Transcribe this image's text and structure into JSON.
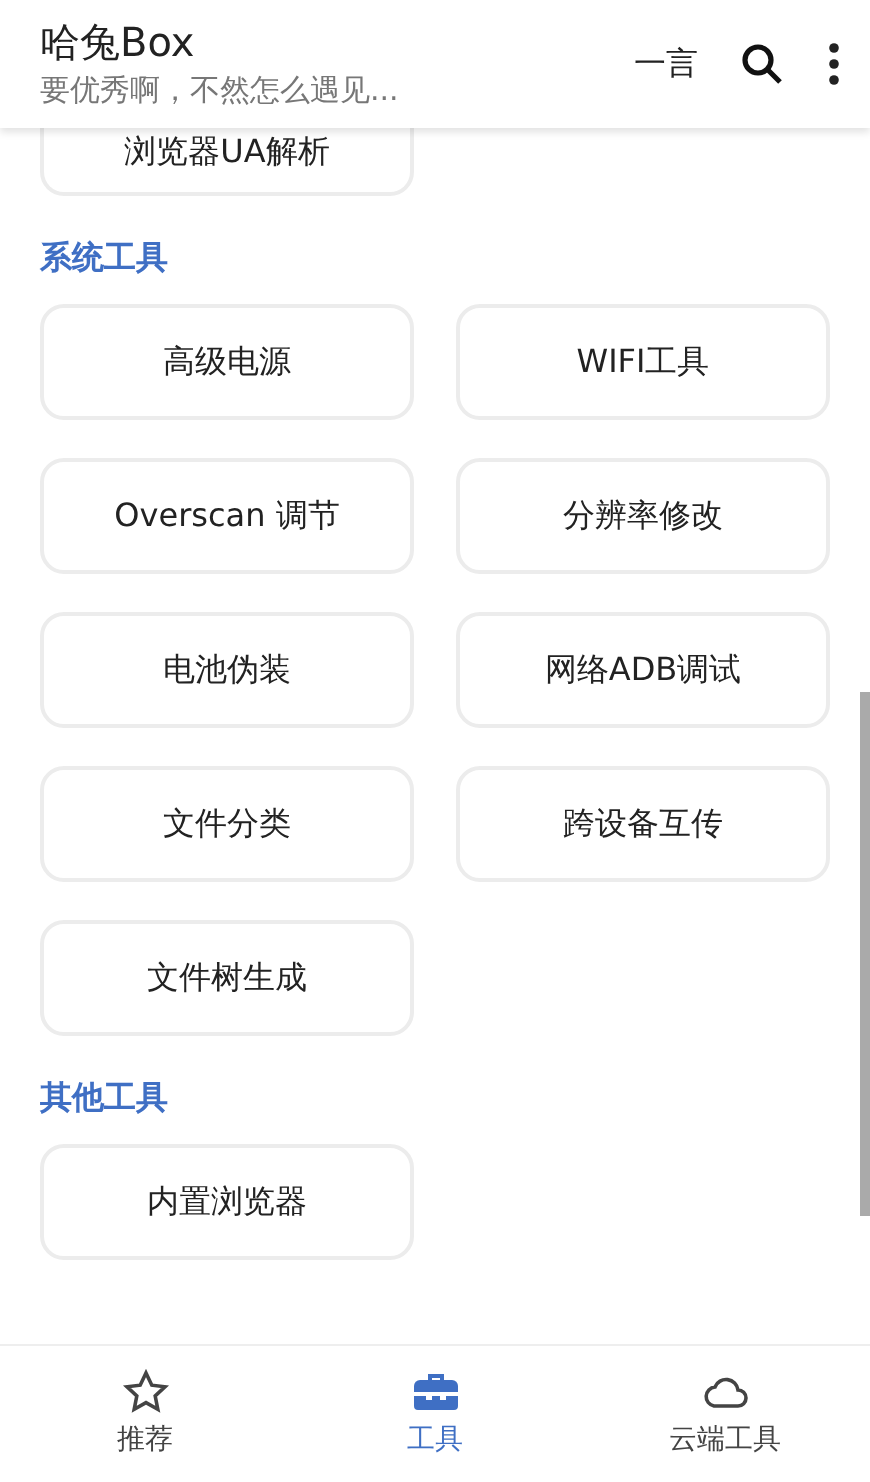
{
  "app_bar": {
    "title": "哈兔Box",
    "subtitle": "要优秀啊，不然怎么遇见...",
    "action_text": "一言"
  },
  "top_item": "浏览器UA解析",
  "sections": [
    {
      "title": "系统工具",
      "items": [
        "高级电源",
        "WIFI工具",
        "Overscan 调节",
        "分辨率修改",
        "电池伪装",
        "网络ADB调试",
        "文件分类",
        "跨设备互传",
        "文件树生成"
      ]
    },
    {
      "title": "其他工具",
      "items": [
        "内置浏览器"
      ]
    }
  ],
  "bottom_nav": [
    {
      "label": "推荐",
      "kind": "star",
      "selected": false
    },
    {
      "label": "工具",
      "kind": "toolbox",
      "selected": true
    },
    {
      "label": "云端工具",
      "kind": "cloud",
      "selected": false
    }
  ]
}
